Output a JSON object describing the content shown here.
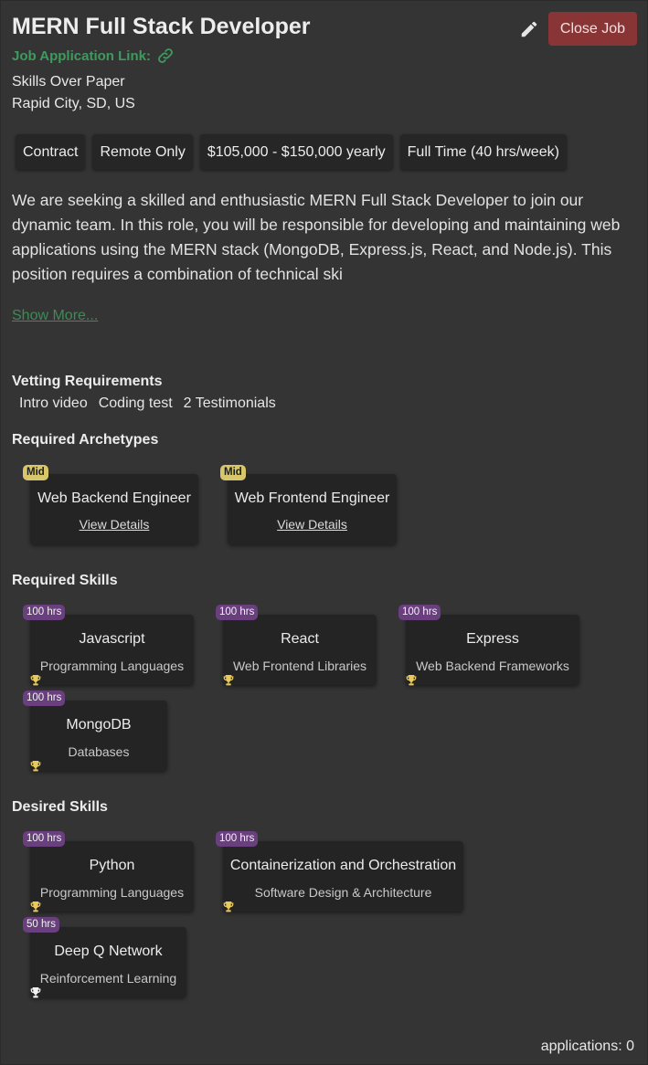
{
  "job": {
    "title": "MERN Full Stack Developer",
    "application_link_label": "Job Application Link:",
    "company": "Skills Over Paper",
    "location": "Rapid City, SD, US",
    "close_button": "Close Job",
    "chips": [
      "Contract",
      "Remote Only",
      "$105,000 - $150,000 yearly",
      "Full Time (40 hrs/week)"
    ],
    "description": "We are seeking a skilled and enthusiastic MERN Full Stack Developer to join our dynamic team. In this role, you will be responsible for developing and maintaining web applications using the MERN stack (MongoDB, Express.js, React, and Node.js). This position requires a combination of technical ski",
    "show_more": "Show More..."
  },
  "vetting": {
    "heading": "Vetting Requirements",
    "items": [
      "Intro video",
      "Coding test",
      "2 Testimonials"
    ]
  },
  "archetypes": {
    "heading": "Required Archetypes",
    "items": [
      {
        "level": "Mid",
        "name": "Web Backend Engineer",
        "link": "View Details"
      },
      {
        "level": "Mid",
        "name": "Web Frontend Engineer",
        "link": "View Details"
      }
    ]
  },
  "required_skills": {
    "heading": "Required Skills",
    "items": [
      {
        "hours": "100 hrs",
        "name": "Javascript",
        "category": "Programming Languages"
      },
      {
        "hours": "100 hrs",
        "name": "React",
        "category": "Web Frontend Libraries"
      },
      {
        "hours": "100 hrs",
        "name": "Express",
        "category": "Web Backend Frameworks"
      },
      {
        "hours": "100 hrs",
        "name": "MongoDB",
        "category": "Databases"
      }
    ]
  },
  "desired_skills": {
    "heading": "Desired Skills",
    "items": [
      {
        "hours": "100 hrs",
        "name": "Python",
        "category": "Programming Languages"
      },
      {
        "hours": "100 hrs",
        "name": "Containerization and Orchestration",
        "category": "Software Design & Architecture"
      },
      {
        "hours": "50 hrs",
        "name": "Deep Q Network",
        "category": "Reinforcement Learning"
      }
    ]
  },
  "footer": {
    "applications": "applications: 0"
  },
  "colors": {
    "background": "#343434",
    "accent_green": "#3f9a5e",
    "close_button": "#8a3535",
    "mid_badge": "#d8c76a",
    "hours_badge": "#6a3f7e",
    "trophy_gold": "#e8c95a",
    "trophy_white": "#f2f2f2"
  },
  "icons": {
    "edit": "pencil-icon",
    "link": "link-icon",
    "skill_marker": "trophy-icon"
  }
}
